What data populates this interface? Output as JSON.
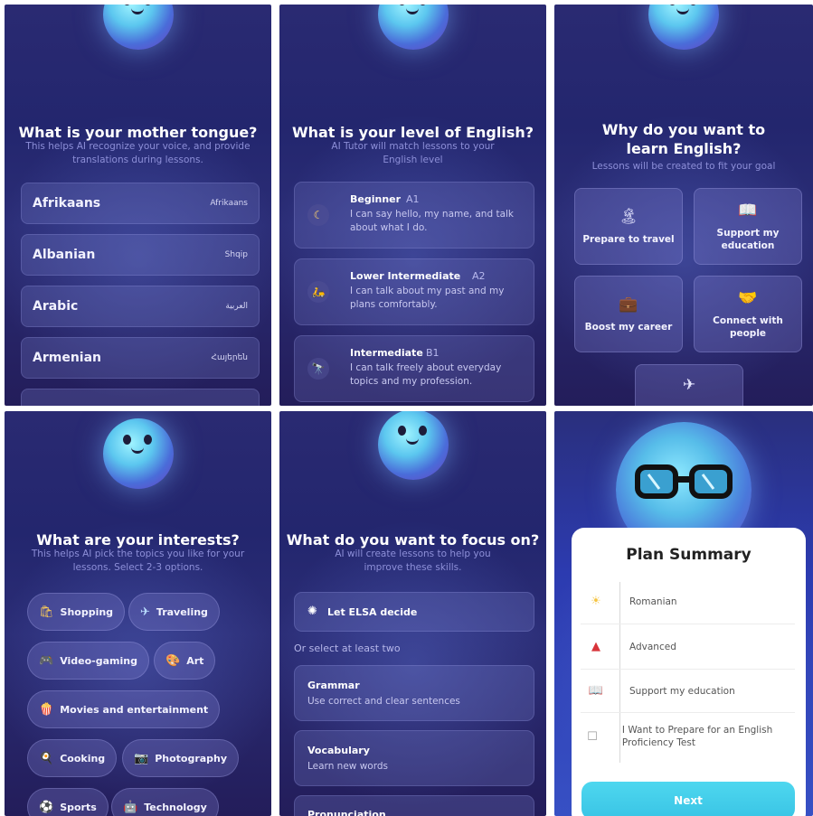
{
  "screen1": {
    "title": "What is your mother tongue?",
    "subtitle": "This helps AI recognize your voice, and provide translations during lessons.",
    "languages": [
      {
        "name": "Afrikaans",
        "native": "Afrikaans"
      },
      {
        "name": "Albanian",
        "native": "Shqip"
      },
      {
        "name": "Arabic",
        "native": "العربية"
      },
      {
        "name": "Armenian",
        "native": "Հայերեն"
      }
    ]
  },
  "screen2": {
    "title": "What is your level of English?",
    "subtitle": "AI Tutor will match lessons to your English level",
    "levels": [
      {
        "name": "Beginner",
        "code": "A1",
        "desc": "I can say hello, my name, and talk about what I do.",
        "icon": "moon-icon"
      },
      {
        "name": "Lower Intermediate",
        "code": "A2",
        "desc": "I can talk about my past and my plans comfortably.",
        "icon": "scooter-icon"
      },
      {
        "name": "Intermediate",
        "code": "B1",
        "desc": "I can talk freely about everyday topics and my profession.",
        "icon": "telescope-icon"
      }
    ]
  },
  "screen3": {
    "title": "Why do you want to learn English?",
    "subtitle": "Lessons will be created to fit your goal",
    "goals": [
      {
        "label": "Prepare to travel",
        "icon": "island-icon"
      },
      {
        "label": "Support my education",
        "icon": "book-icon"
      },
      {
        "label": "Boost my career",
        "icon": "briefcase-icon"
      },
      {
        "label": "Connect with people",
        "icon": "handshake-icon"
      },
      {
        "label": "",
        "icon": "airplane-icon"
      }
    ]
  },
  "screen4": {
    "title": "What are your interests?",
    "subtitle": "This helps AI pick the topics you like for your lessons. Select 2-3 options.",
    "interests": [
      {
        "label": "Shopping",
        "icon": "shopping-bag-icon"
      },
      {
        "label": "Traveling",
        "icon": "airplane-icon"
      },
      {
        "label": "Video-gaming",
        "icon": "gamepad-icon"
      },
      {
        "label": "Art",
        "icon": "palette-icon"
      },
      {
        "label": "Movies and entertainment",
        "icon": "popcorn-icon"
      },
      {
        "label": "Cooking",
        "icon": "cooking-icon"
      },
      {
        "label": "Photography",
        "icon": "camera-icon"
      },
      {
        "label": "Sports",
        "icon": "ball-icon"
      },
      {
        "label": "Technology",
        "icon": "robot-icon"
      }
    ]
  },
  "screen5": {
    "title": "What do you want to focus on?",
    "subtitle": "AI will create lessons to help you improve these skills.",
    "auto_option": "Let ELSA decide",
    "select_hint": "Or select at least two",
    "skills": [
      {
        "title": "Grammar",
        "desc": "Use correct and clear sentences"
      },
      {
        "title": "Vocabulary",
        "desc": "Learn new words"
      },
      {
        "title": "Pronunciation",
        "desc": ""
      }
    ]
  },
  "screen6": {
    "title": "Plan Summary",
    "items": [
      {
        "text": "Romanian",
        "icon": "sun-icon"
      },
      {
        "text": "Advanced",
        "icon": "chart-icon"
      },
      {
        "text": "Support my education",
        "icon": "book-icon"
      },
      {
        "text": "I Want to Prepare for an English Proficiency Test",
        "icon": "checkbox-icon"
      }
    ],
    "next_label": "Next"
  }
}
